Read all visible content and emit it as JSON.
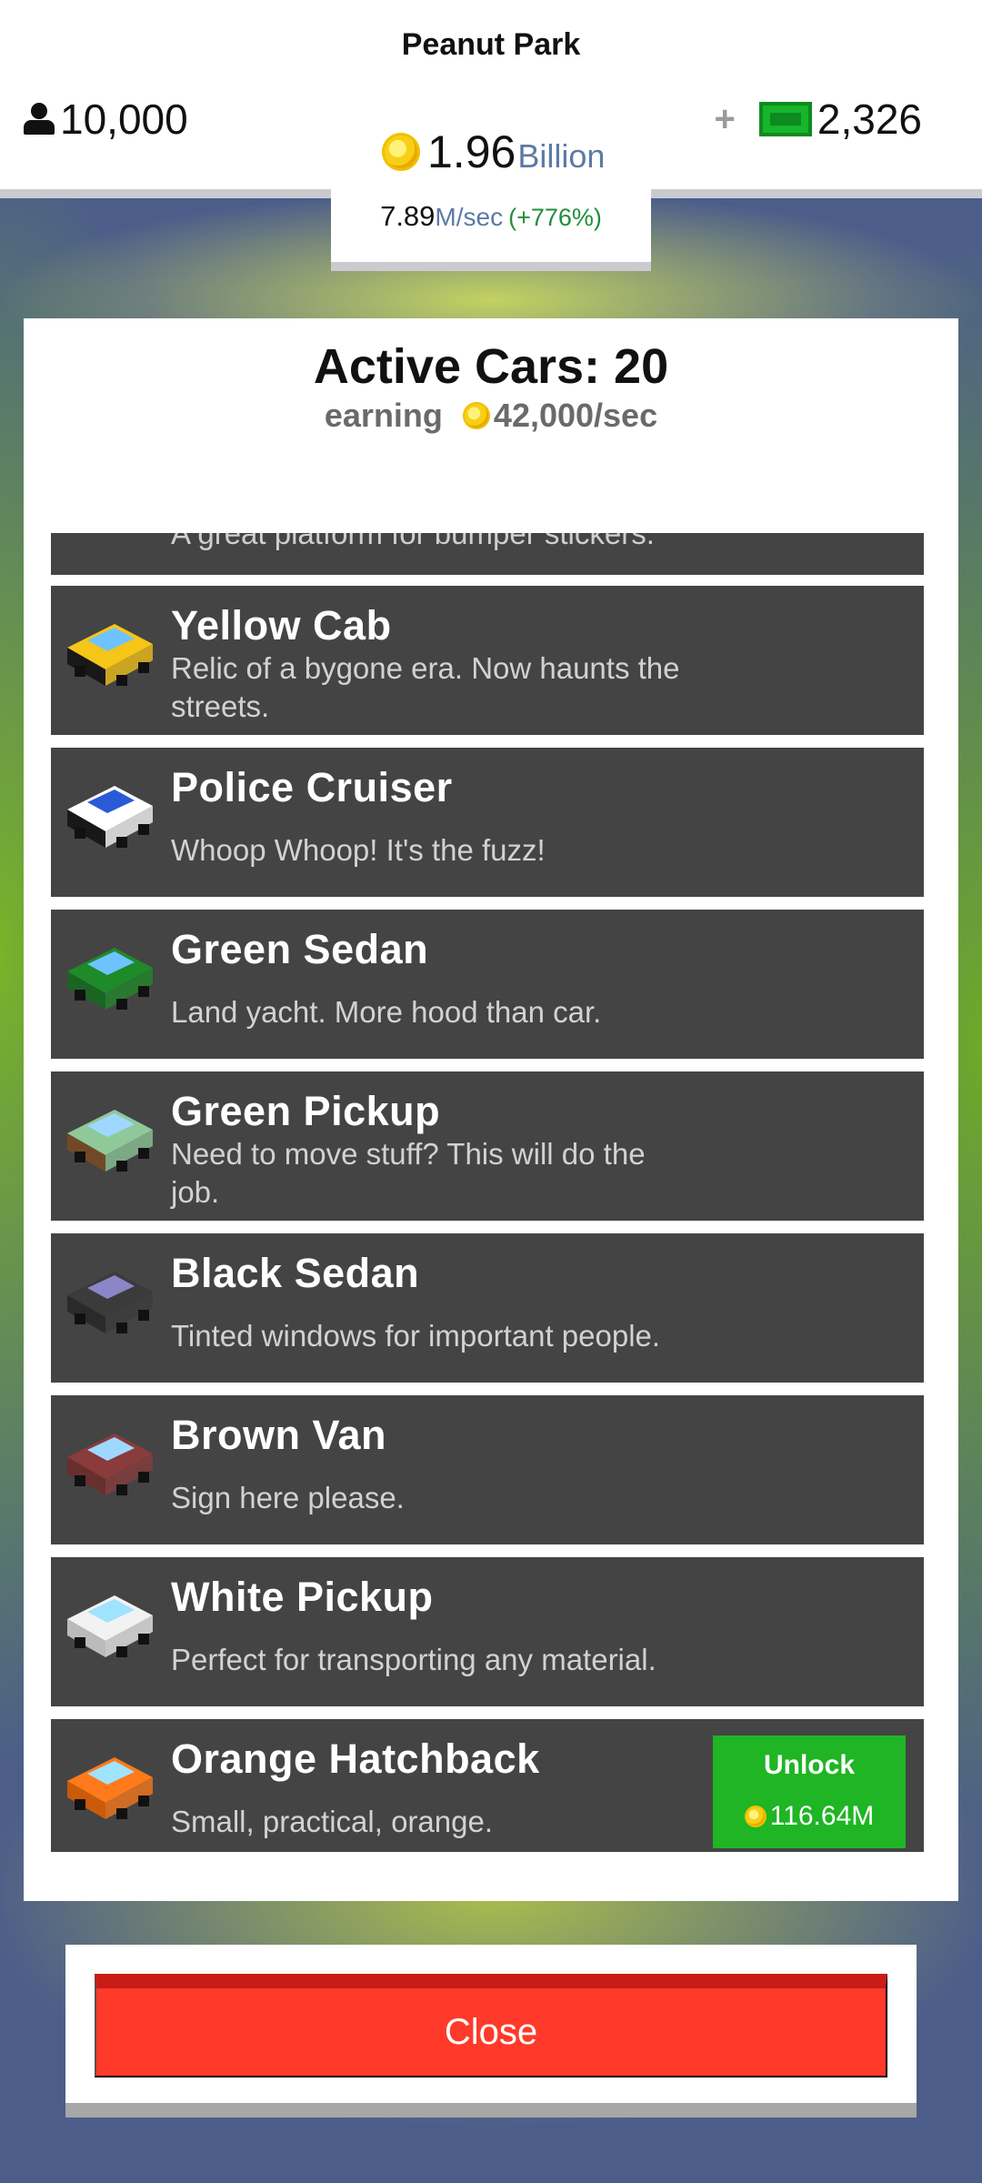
{
  "hud": {
    "park_name": "Peanut Park",
    "visitors": "10,000",
    "coins_value": "1.96",
    "coins_unit": "Billion",
    "rate_value": "7.89",
    "rate_unit": "M/sec",
    "rate_pct": "(+776%)",
    "plus_symbol": "+",
    "cash": "2,326"
  },
  "panel": {
    "title": "Active Cars: 20",
    "earning_label": "earning",
    "earning_value": "42,000/sec",
    "partial_desc": "A great platform for bumper stickers."
  },
  "cars": [
    {
      "name": "Yellow Cab",
      "desc": "Relic of a bygone era. Now haunts the streets.",
      "icon": "yellow-cab-icon",
      "colors": {
        "body": "#f5c518",
        "top": "#111111",
        "accent": "#6ec3ff"
      }
    },
    {
      "name": "Police Cruiser",
      "desc": "Whoop Whoop! It's the fuzz!",
      "icon": "police-cruiser-icon",
      "colors": {
        "body": "#ffffff",
        "top": "#111111",
        "accent": "#2a5bd7"
      }
    },
    {
      "name": "Green Sedan",
      "desc": "Land yacht. More hood than car.",
      "icon": "green-sedan-icon",
      "colors": {
        "body": "#1f8a2a",
        "top": "#146a1e",
        "accent": "#6ec3ff"
      }
    },
    {
      "name": "Green Pickup",
      "desc": "Need to move stuff? This will do the job.",
      "icon": "green-pickup-icon",
      "colors": {
        "body": "#8fc99a",
        "top": "#7a4a22",
        "accent": "#9fd8ff"
      }
    },
    {
      "name": "Black Sedan",
      "desc": "Tinted windows for important people.",
      "icon": "black-sedan-icon",
      "colors": {
        "body": "#3b3b3b",
        "top": "#262626",
        "accent": "#8a86c8"
      }
    },
    {
      "name": "Brown Van",
      "desc": "Sign here please.",
      "icon": "brown-van-icon",
      "colors": {
        "body": "#8a3b3b",
        "top": "#6e2c2c",
        "accent": "#9fd8ff"
      }
    },
    {
      "name": "White Pickup",
      "desc": "Perfect for transporting any material.",
      "icon": "white-pickup-icon",
      "colors": {
        "body": "#f2f2f2",
        "top": "#d0d0d0",
        "accent": "#9fe3ff"
      }
    },
    {
      "name": "Orange Hatchback",
      "desc": "Small, practical, orange.",
      "icon": "orange-hatchback-icon",
      "colors": {
        "body": "#ff7a1a",
        "top": "#e35e00",
        "accent": "#9fe3ff"
      }
    }
  ],
  "unlock": {
    "label": "Unlock",
    "price": "116.64M"
  },
  "close_label": "Close",
  "colors": {
    "row_bg": "#444444",
    "unlock_green": "#1fb524",
    "close_red": "#ff3a2a",
    "rate_green": "#1f8f3a",
    "unit_blue": "#5c7aa6"
  }
}
